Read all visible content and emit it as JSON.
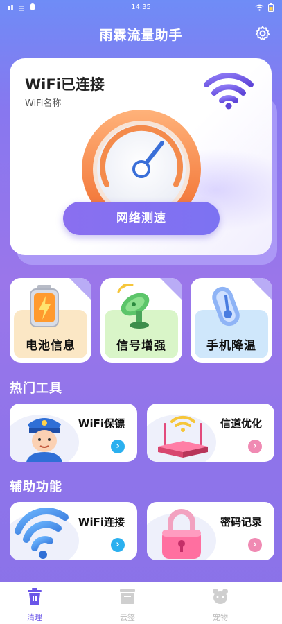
{
  "status_bar": {
    "time": "14:35"
  },
  "app": {
    "title": "雨霖流量助手"
  },
  "connection": {
    "status": "WiFi已连接",
    "network_name": "WiFi名称",
    "speed_test_label": "网络测速"
  },
  "quick_tools": [
    {
      "label": "电池信息"
    },
    {
      "label": "信号增强"
    },
    {
      "label": "手机降温"
    }
  ],
  "hot_tools": {
    "title": "热门工具",
    "items": [
      {
        "label": "WiFi保镖"
      },
      {
        "label": "信道优化"
      }
    ]
  },
  "aux_tools": {
    "title": "辅助功能",
    "items": [
      {
        "label": "WiFi连接"
      },
      {
        "label": "密码记录"
      }
    ]
  },
  "tabbar": {
    "items": [
      {
        "label": "清理",
        "active": true
      },
      {
        "label": "云签",
        "active": false
      },
      {
        "label": "宠物",
        "active": false
      }
    ]
  },
  "colors": {
    "accent": "#6a55e8",
    "background": "#8b79ee",
    "arrow_blue": "#2bb0ef",
    "arrow_pink": "#f08ab3"
  }
}
